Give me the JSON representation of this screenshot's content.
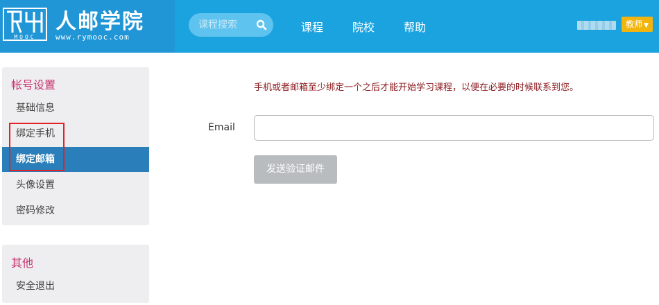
{
  "header": {
    "logo_text": "人邮学院",
    "logo_url": "www.rymooc.com",
    "search_placeholder": "课程搜索",
    "nav": [
      "课程",
      "院校",
      "帮助"
    ],
    "role_label": "教师",
    "icons": {
      "logo": "rymooc-logo",
      "search": "search-icon",
      "dropdown": "caret-down-icon"
    },
    "colors": {
      "bar": "#1ba3e0",
      "logo_bg": "#2196d6",
      "badge": "#f2b50f"
    }
  },
  "sidebar": {
    "account_title": "帐号设置",
    "account_items": [
      "基础信息",
      "绑定手机",
      "绑定邮箱",
      "头像设置",
      "密码修改"
    ],
    "active_item": "绑定邮箱",
    "other_title": "其他",
    "other_items": [
      "安全退出"
    ],
    "colors": {
      "title": "#c83271",
      "active_bg": "#2a7fba"
    }
  },
  "main": {
    "notice": "手机或者邮箱至少绑定一个之后才能开始学习课程，以便在必要的时候联系到您。",
    "email_label": "Email",
    "email_value": "",
    "send_button": "发送验证邮件"
  }
}
